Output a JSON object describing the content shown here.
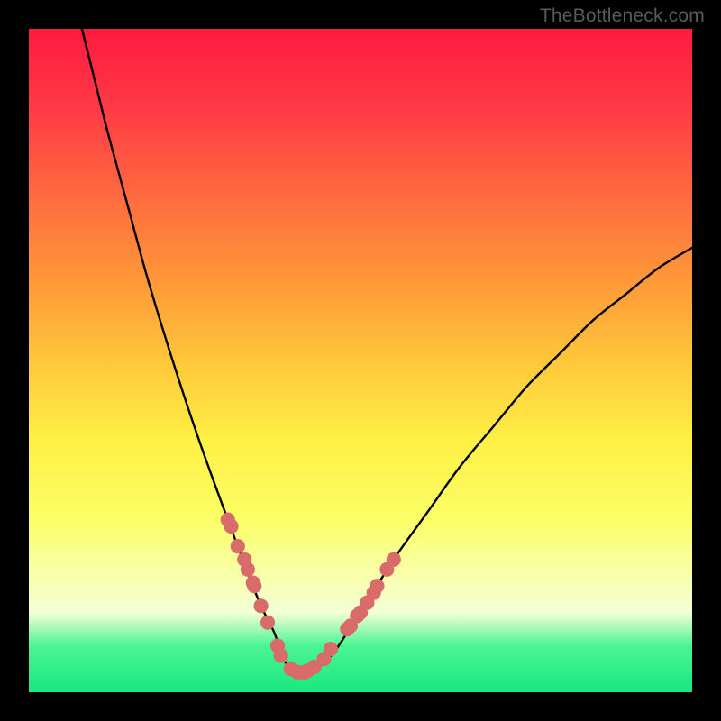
{
  "watermark": "TheBottleneck.com",
  "chart_data": {
    "type": "line",
    "title": "",
    "xlabel": "",
    "ylabel": "",
    "xlim": [
      0,
      100
    ],
    "ylim": [
      0,
      100
    ],
    "grid": false,
    "legend": false,
    "series": [
      {
        "name": "bottleneck-curve",
        "color": "#000000",
        "x": [
          8,
          10,
          12,
          15,
          18,
          22,
          26,
          30,
          33,
          35,
          37,
          38,
          39,
          40,
          42,
          44,
          46,
          48,
          50,
          55,
          60,
          65,
          70,
          75,
          80,
          85,
          90,
          95,
          100
        ],
        "y": [
          100,
          92,
          84,
          73,
          62,
          49,
          37,
          26,
          18,
          13,
          9,
          6,
          4,
          3,
          3,
          4,
          6,
          9,
          12,
          20,
          27,
          34,
          40,
          46,
          51,
          56,
          60,
          64,
          67
        ]
      }
    ],
    "markers": {
      "name": "data-points",
      "color": "#d96b6b",
      "radius_pct": 1.1,
      "x": [
        30.0,
        30.5,
        31.5,
        32.5,
        33.0,
        33.8,
        34.0,
        35.0,
        36.0,
        37.5,
        38.0,
        39.5,
        40.5,
        41.5,
        42.0,
        43.0,
        44.5,
        45.5,
        48.0,
        48.5,
        49.5,
        50.0,
        51.0,
        52.0,
        52.5,
        54.0,
        55.0
      ],
      "y": [
        26.0,
        25.0,
        22.0,
        20.0,
        18.5,
        16.5,
        16.0,
        13.0,
        10.5,
        7.0,
        5.5,
        3.5,
        3.0,
        3.0,
        3.2,
        3.8,
        5.0,
        6.5,
        9.5,
        10.0,
        11.5,
        12.0,
        13.5,
        15.0,
        16.0,
        18.5,
        20.0
      ]
    }
  }
}
